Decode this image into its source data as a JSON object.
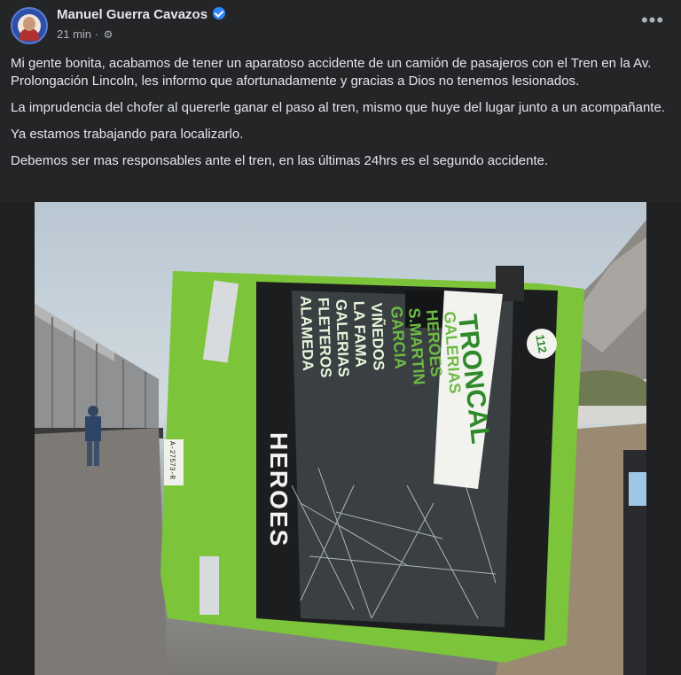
{
  "post": {
    "author": "Manuel Guerra Cavazos",
    "time": "21 min",
    "audience_icon": "gear-icon",
    "more_icon": "more-options-icon",
    "paragraphs": [
      "Mi gente bonita, acabamos de tener un aparatoso accidente de un camión de pasajeros con el Tren en la Av. Prolongación Lincoln, les informo que afortunadamente y gracias a Dios no tenemos lesionados.",
      "La imprudencia del chofer al quererle ganar el paso al tren, mismo que huye del lugar junto a un acompañante.",
      "Ya estamos trabajando para localizarlo.",
      "Debemos ser mas responsables ante el tren, en las últimas 24hrs es el segundo accidente."
    ]
  },
  "photo": {
    "bus_side_text": "HEROES",
    "route_sign_lines": [
      "ALAMEDA",
      "FLETEROS",
      "GALERIAS",
      "LA FAMA",
      "VIÑEDOS"
    ],
    "route_name": "TRONCAL",
    "route_stops": [
      "GARCIA",
      "S.MARTIN",
      "HEROES",
      "GALERIAS"
    ],
    "unit_number": "112",
    "plate": "A-27573-R",
    "colors": {
      "bus_green": "#7cc43a",
      "bus_black": "#1c1d1f"
    }
  }
}
